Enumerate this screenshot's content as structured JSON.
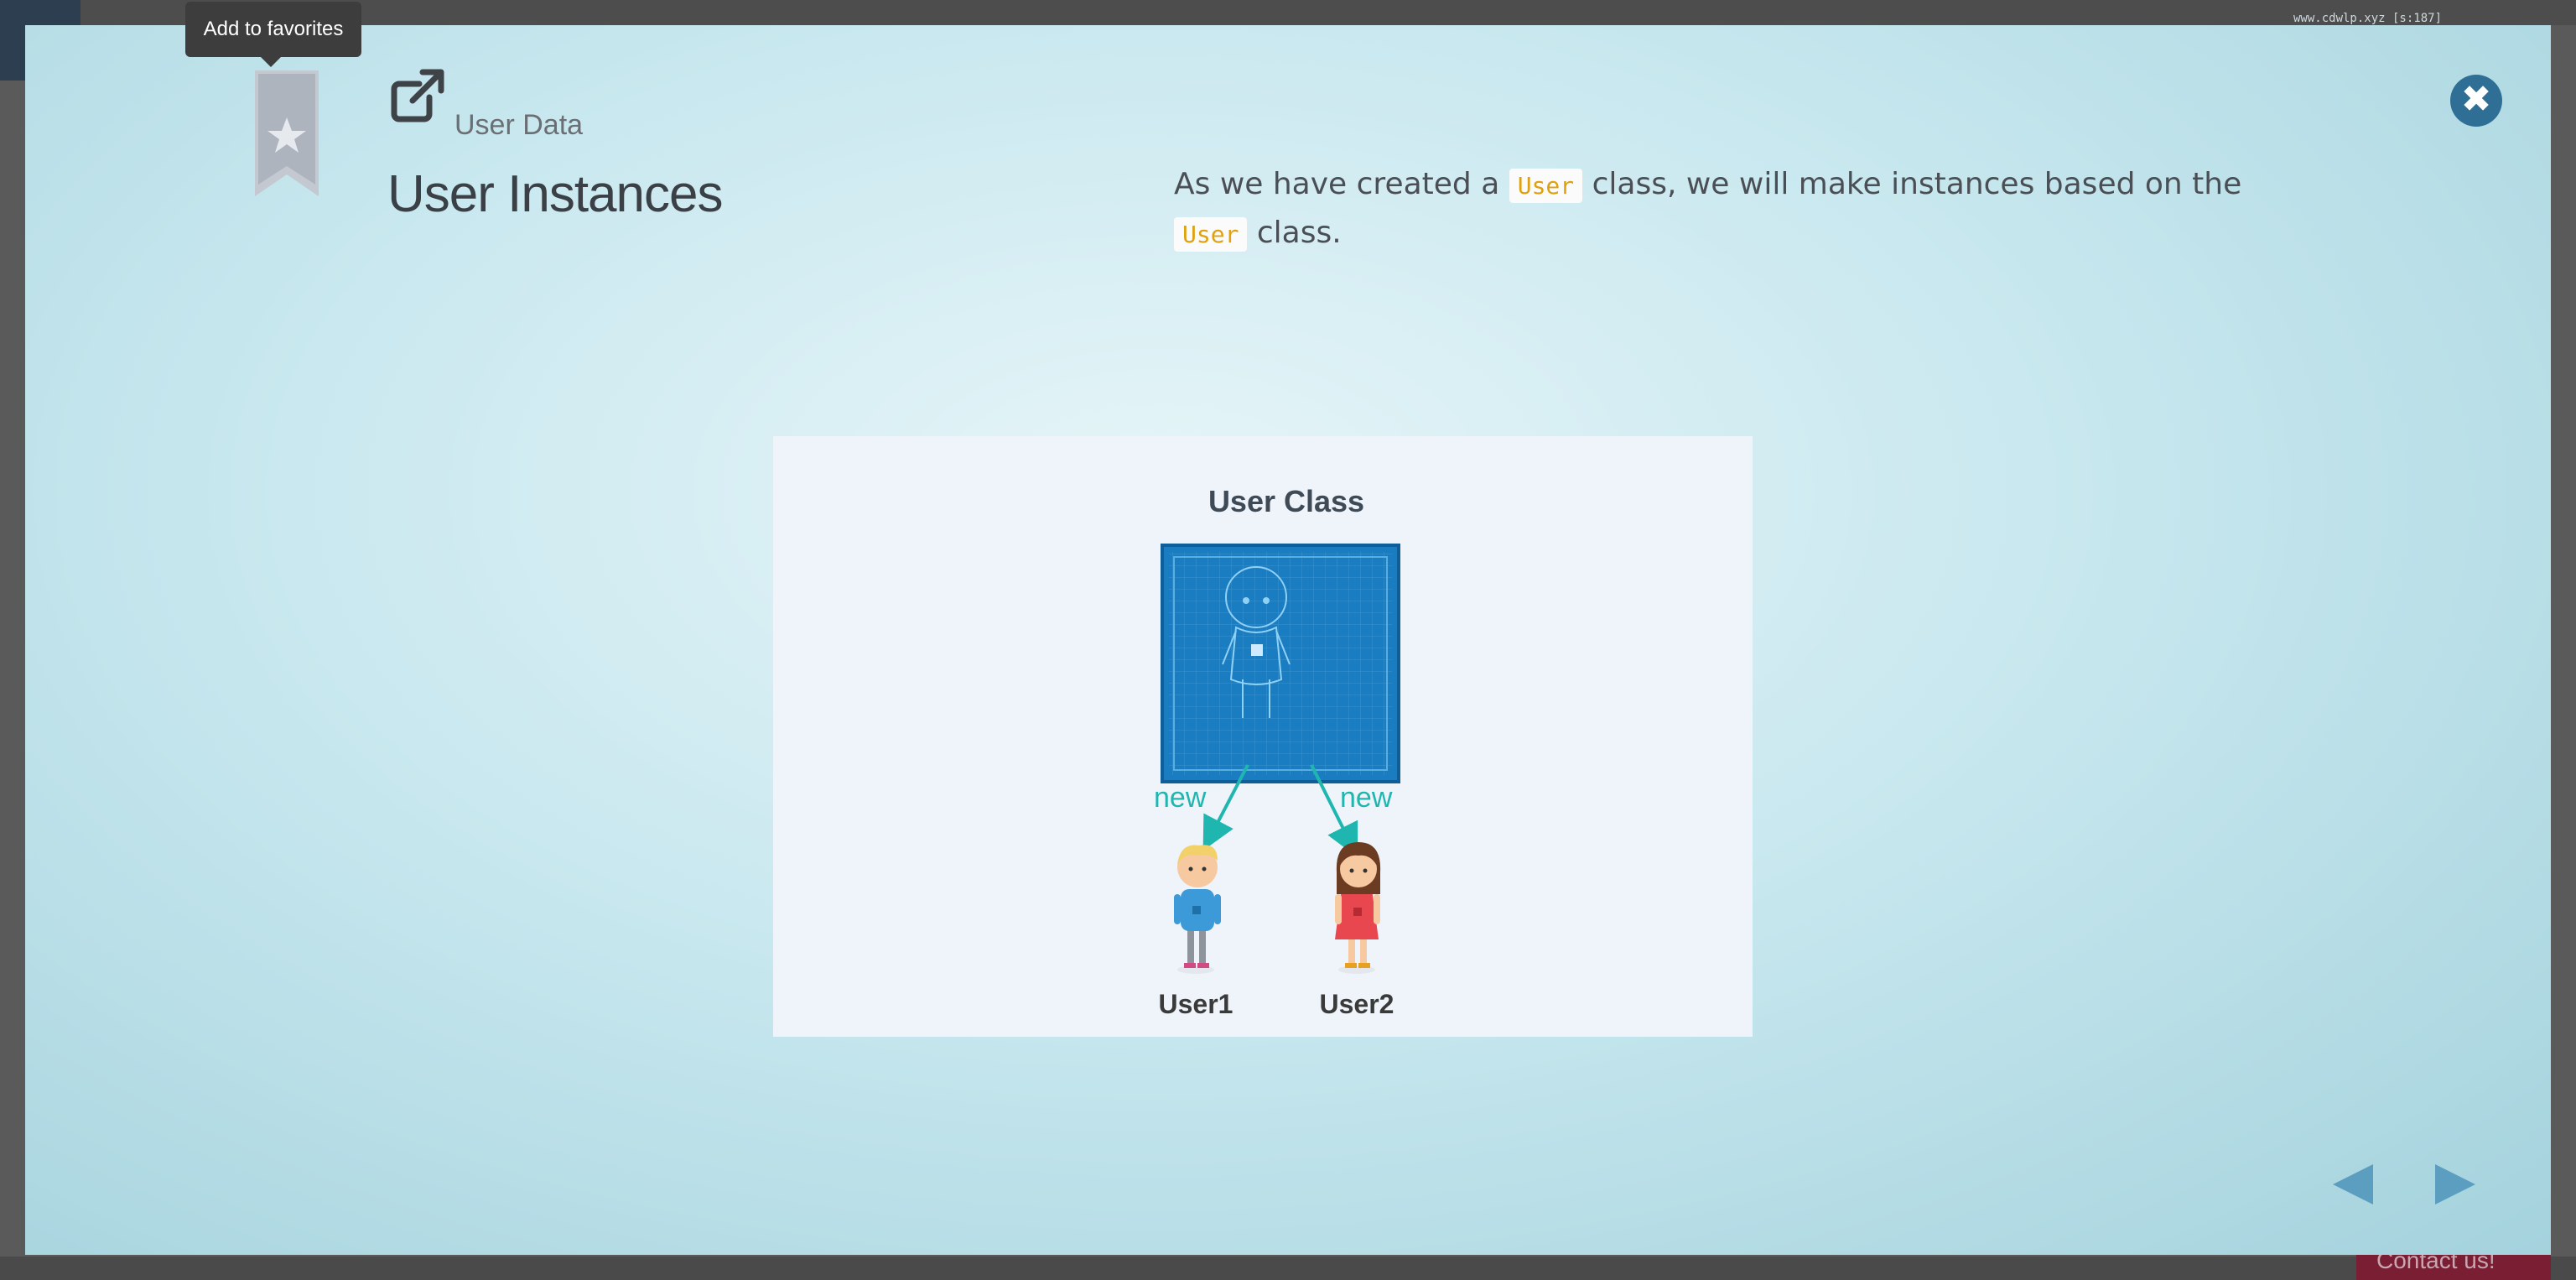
{
  "background": {
    "address_text": "www.cdwlp.xyz [s:187]",
    "contact_label": "Contact us!"
  },
  "tooltip": {
    "text": "Add to favorites"
  },
  "header": {
    "section_label": "User Data",
    "title": "User Instances"
  },
  "description": {
    "part1": "As we have created a ",
    "code1": "User",
    "part2": " class, we will make instances based on the ",
    "code2": "User",
    "part3": " class."
  },
  "figure": {
    "title": "User Class",
    "arrow_left_label": "new",
    "arrow_right_label": "new",
    "user1_label": "User1",
    "user2_label": "User2"
  },
  "colors": {
    "modal_bg_center": "#e6f5f8",
    "modal_bg_edge": "#a4d2dd",
    "close_button": "#2f6f95",
    "code_text": "#e0a10c",
    "blueprint": "#1a7cc1",
    "arrow": "#1fb6b0",
    "nav_arrow": "#5b9ec0"
  },
  "icons": {
    "close": "close-icon",
    "bookmark": "bookmark-star-icon",
    "external": "external-link-icon",
    "prev": "prev-arrow-icon",
    "next": "next-arrow-icon"
  }
}
